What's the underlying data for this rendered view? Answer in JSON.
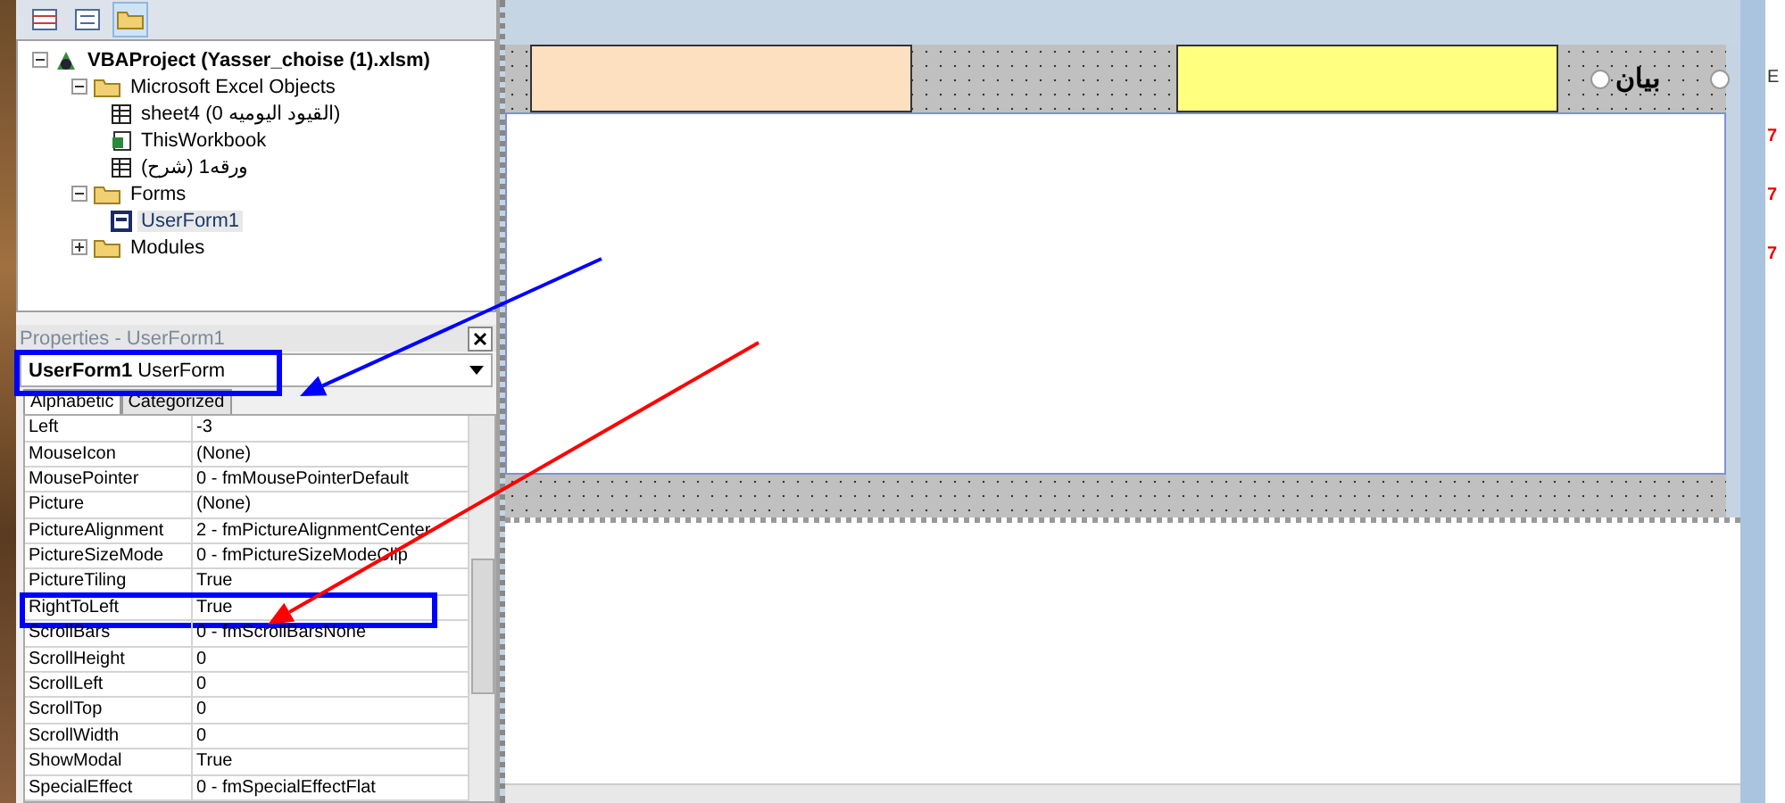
{
  "project_explorer": {
    "toolbar": [
      {
        "kind": "view-code",
        "selected": false
      },
      {
        "kind": "view-object",
        "selected": false
      },
      {
        "kind": "toggle-folders",
        "selected": true
      }
    ],
    "tree": [
      {
        "label": "VBAProject (Yasser_choise (1).xlsm)",
        "kind": "project",
        "expanded": true,
        "selected": false,
        "children": [
          {
            "label": "Microsoft Excel Objects",
            "kind": "folder",
            "expanded": true,
            "selected": false,
            "children": [
              {
                "label": "sheet4 (القيود اليوميه 0)",
                "kind": "sheet",
                "selected": false
              },
              {
                "label": "ThisWorkbook",
                "kind": "workbook",
                "selected": false
              },
              {
                "label": "ورقه1 (شرح)",
                "kind": "sheet",
                "selected": false
              }
            ]
          },
          {
            "label": "Forms",
            "kind": "folder",
            "expanded": true,
            "selected": false,
            "children": [
              {
                "label": "UserForm1",
                "kind": "form",
                "selected": true
              }
            ]
          },
          {
            "label": "Modules",
            "kind": "folder",
            "expanded": false,
            "selected": false
          }
        ]
      }
    ]
  },
  "properties": {
    "title": "Properties - UserForm1",
    "object_name": "UserForm1",
    "object_type": "UserForm",
    "highlighted": true,
    "tabs": [
      {
        "label": "Alphabetic",
        "selected": true
      },
      {
        "label": "Categorized",
        "selected": false
      }
    ],
    "rows": [
      {
        "name": "Left",
        "value": "-3",
        "highlighted": false
      },
      {
        "name": "MouseIcon",
        "value": "(None)",
        "highlighted": false
      },
      {
        "name": "MousePointer",
        "value": "0 - fmMousePointerDefault",
        "highlighted": false
      },
      {
        "name": "Picture",
        "value": "(None)",
        "highlighted": false
      },
      {
        "name": "PictureAlignment",
        "value": "2 - fmPictureAlignmentCenter",
        "highlighted": false
      },
      {
        "name": "PictureSizeMode",
        "value": "0 - fmPictureSizeModeClip",
        "highlighted": false
      },
      {
        "name": "PictureTiling",
        "value": "True",
        "highlighted": false
      },
      {
        "name": "RightToLeft",
        "value": "True",
        "highlighted": true
      },
      {
        "name": "ScrollBars",
        "value": "0 - fmScrollBarsNone",
        "highlighted": false
      },
      {
        "name": "ScrollHeight",
        "value": "0",
        "highlighted": false
      },
      {
        "name": "ScrollLeft",
        "value": "0",
        "highlighted": false
      },
      {
        "name": "ScrollTop",
        "value": "0",
        "highlighted": false
      },
      {
        "name": "ScrollWidth",
        "value": "0",
        "highlighted": false
      },
      {
        "name": "ShowModal",
        "value": "True",
        "highlighted": false
      },
      {
        "name": "SpecialEffect",
        "value": "0 - fmSpecialEffectFlat",
        "highlighted": false
      }
    ]
  },
  "form_designer": {
    "controls": [
      {
        "kind": "textbox",
        "color": "#fde0c0"
      },
      {
        "kind": "textbox",
        "color": "#ffff80"
      },
      {
        "kind": "option"
      },
      {
        "kind": "label",
        "text": "بيان"
      },
      {
        "kind": "option"
      }
    ]
  },
  "background_window": {
    "texts": [
      "E",
      "7",
      "7",
      "7"
    ]
  },
  "annotations": [
    {
      "kind": "arrow",
      "color": "#0000ff"
    },
    {
      "kind": "arrow",
      "color": "#ff0000"
    }
  ]
}
